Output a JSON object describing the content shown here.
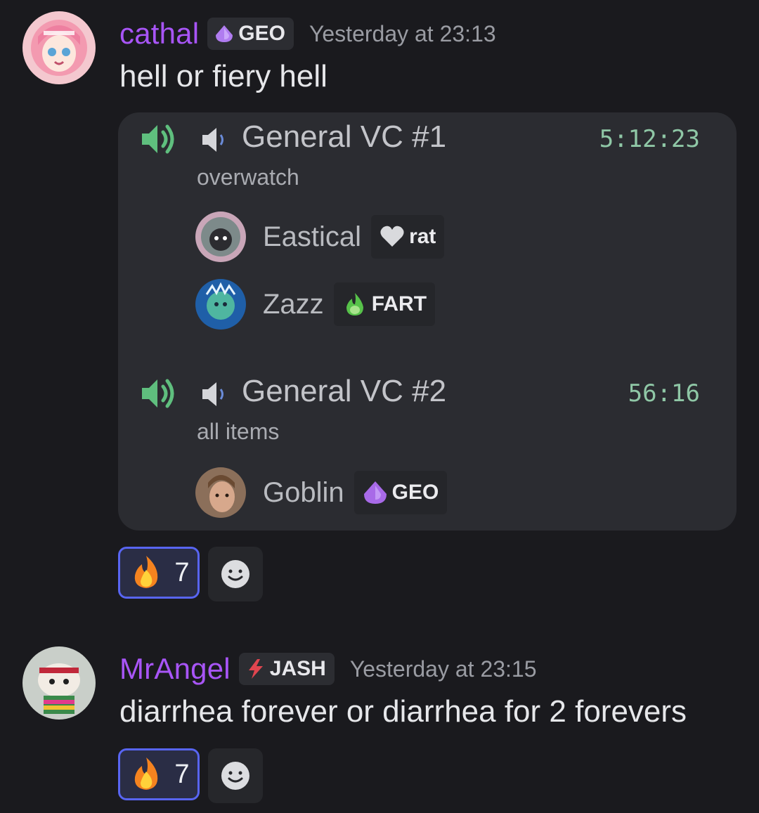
{
  "messages": [
    {
      "username": "cathal",
      "tag": "GEO",
      "timestamp": "Yesterday at 23:13",
      "content": "hell or fiery hell",
      "embed": {
        "channels": [
          {
            "name": "General VC #1",
            "time": "5:12:23",
            "activity": "overwatch",
            "members": [
              {
                "name": "Eastical",
                "tag": "rat"
              },
              {
                "name": "Zazz",
                "tag": "FART"
              }
            ]
          },
          {
            "name": "General VC #2",
            "time": "56:16",
            "activity": "all items",
            "members": [
              {
                "name": "Goblin",
                "tag": "GEO"
              }
            ]
          }
        ]
      },
      "reactions": [
        {
          "emoji": "fire-icon",
          "count": "7"
        }
      ]
    },
    {
      "username": "MrAngel",
      "tag": "JASH",
      "timestamp": "Yesterday at 23:15",
      "content": "diarrhea forever or diarrhea for 2 forevers",
      "reactions": [
        {
          "emoji": "fire-icon",
          "count": "7"
        }
      ]
    }
  ],
  "colors": {
    "background": "#1a1a1e",
    "embed": "#2b2c31",
    "username": "#a855f7",
    "vc_time": "#8fc7a6",
    "reaction_border": "#5865f2"
  }
}
